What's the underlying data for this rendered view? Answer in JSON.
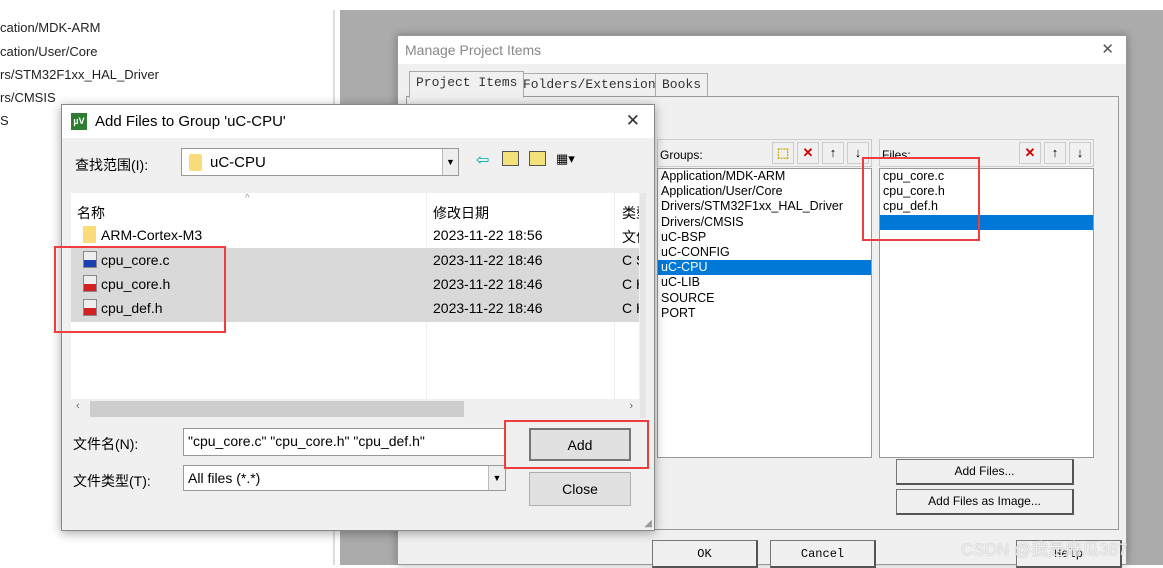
{
  "background_tree": [
    "cation/MDK-ARM",
    "cation/User/Core",
    "rs/STM32F1xx_HAL_Driver",
    "rs/CMSIS",
    "S"
  ],
  "manage": {
    "title": "Manage Project Items",
    "close_glyph": "✕",
    "tabs": [
      "Project Items",
      "Folders/Extensions",
      "Books"
    ],
    "groups_label": "Groups:",
    "groups": [
      "Application/MDK-ARM",
      "Application/User/Core",
      "Drivers/STM32F1xx_HAL_Driver",
      "Drivers/CMSIS",
      "uC-BSP",
      "uC-CONFIG",
      "uC-CPU",
      "uC-LIB",
      "SOURCE",
      "PORT"
    ],
    "selected_group": "uC-CPU",
    "files_label": "Files:",
    "files": [
      "cpu_core.c",
      "cpu_core.h",
      "cpu_def.h"
    ],
    "add_files": "Add Files...",
    "add_files_image": "Add Files as Image...",
    "ok": "OK",
    "cancel": "Cancel",
    "help": "Help"
  },
  "add_dialog": {
    "title": "Add Files to Group 'uC-CPU'",
    "close_glyph": "✕",
    "look_in_label": "查找范围(I):",
    "look_in_value": "uC-CPU",
    "columns": [
      "名称",
      "修改日期",
      "类型"
    ],
    "rows": [
      {
        "name": "ARM-Cortex-M3",
        "date": "2023-11-22 18:56",
        "type": "文件",
        "icon": "folder-icon"
      },
      {
        "name": "cpu_core.c",
        "date": "2023-11-22 18:46",
        "type": "C S",
        "icon": "c-file-icon"
      },
      {
        "name": "cpu_core.h",
        "date": "2023-11-22 18:46",
        "type": "C H",
        "icon": "h-file-icon"
      },
      {
        "name": "cpu_def.h",
        "date": "2023-11-22 18:46",
        "type": "C H",
        "icon": "h-file-icon"
      }
    ],
    "filename_label": "文件名(N):",
    "filename_value": "\"cpu_core.c\" \"cpu_core.h\" \"cpu_def.h\"",
    "filetype_label": "文件类型(T):",
    "filetype_value": "All files (*.*)",
    "add": "Add",
    "close": "Close"
  },
  "highlight_color": "#f03c3c",
  "selection_color": "#0078d7",
  "watermark": "CSDN @我是麻瓜387"
}
